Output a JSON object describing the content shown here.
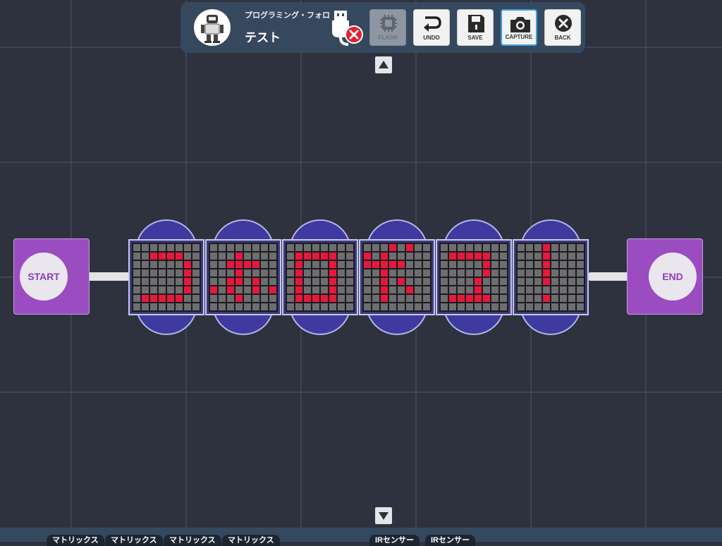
{
  "header": {
    "subtitle": "プログラミング・フォロ",
    "title": "テスト",
    "avatar_icon": "robot-icon",
    "usb_icon": "usb-disconnected-icon"
  },
  "toolbar": {
    "buttons": [
      {
        "label": "FLASH",
        "icon": "chip-icon",
        "enabled": false
      },
      {
        "label": "UNDO",
        "icon": "undo-icon",
        "enabled": true
      },
      {
        "label": "SAVE",
        "icon": "floppy-icon",
        "enabled": true
      },
      {
        "label": "CAPTURE",
        "icon": "camera-icon",
        "enabled": true,
        "active": true
      },
      {
        "label": "BACK",
        "icon": "close-circle-icon",
        "enabled": true
      }
    ]
  },
  "program": {
    "start_label": "START",
    "end_label": "END",
    "matrix_blocks": [
      {
        "char": "コ",
        "rows": [
          "........",
          "..####..",
          "......#.",
          "......#.",
          "......#.",
          "......#.",
          ".#####..",
          "........"
        ]
      },
      {
        "char": "ホ",
        "rows": [
          "........",
          "...#....",
          "..####..",
          "...#....",
          "..##.#..",
          "#.#..#.#",
          "...#....",
          "........"
        ]
      },
      {
        "char": "ロ",
        "rows": [
          "........",
          ".#####..",
          ".#...#..",
          ".#...#..",
          ".#...#..",
          ".#...#..",
          ".#####..",
          "........"
        ]
      },
      {
        "char": "ボ",
        "rows": [
          "...#.#..",
          "#.#.....",
          "#####...",
          "..#.....",
          "..#.#...",
          "..#..#..",
          "..#.....",
          "........"
        ]
      },
      {
        "char": "ン",
        "rows": [
          "........",
          ".#####..",
          ".....#..",
          ".....#..",
          "....#...",
          "....#...",
          ".#####..",
          "........"
        ]
      },
      {
        "char": "!",
        "rows": [
          "...#....",
          "...#....",
          "...#....",
          "...#....",
          "...#....",
          "........",
          "...#....",
          "........"
        ]
      }
    ],
    "colors": {
      "lit": "#e8183a",
      "unlit": "#6e6e6e",
      "node": "#9a4cc0",
      "block": "#3e3aa0"
    }
  },
  "palette": {
    "tabs": [
      "マトリックス",
      "マトリックス",
      "マトリックス",
      "マトリックス",
      "IRセンサー",
      "IRセンサー"
    ]
  }
}
